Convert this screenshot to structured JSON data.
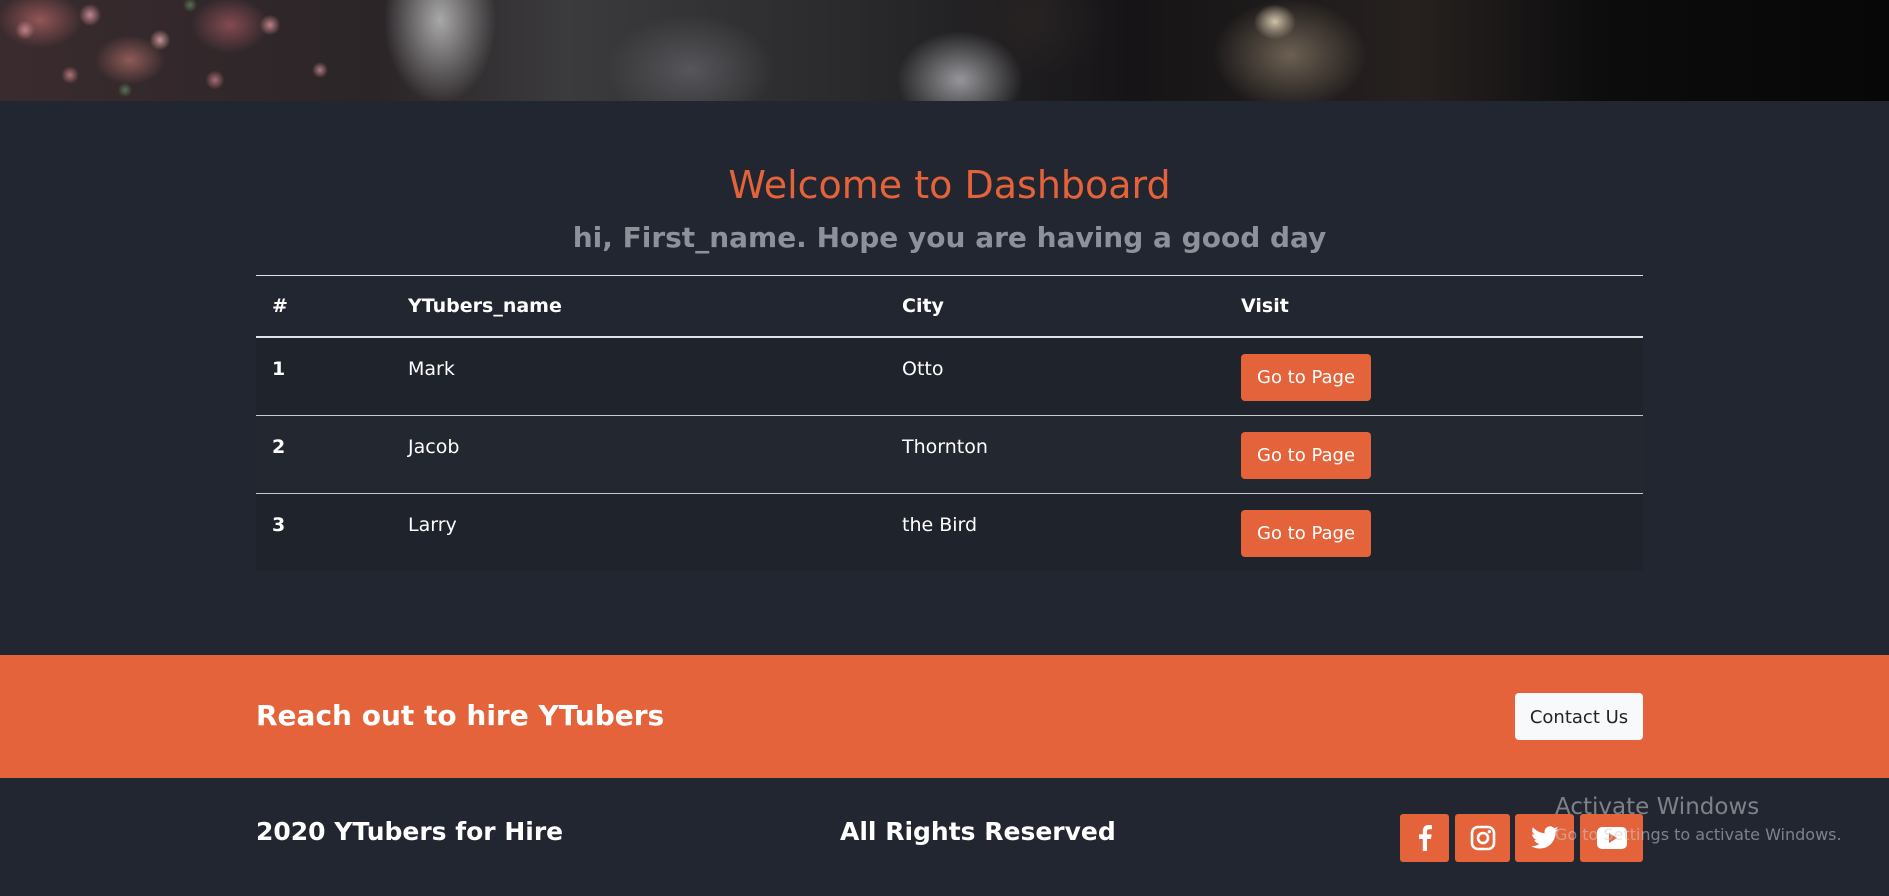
{
  "hero": {
    "image_name": "hero-photo"
  },
  "dashboard": {
    "title": "Welcome to Dashboard",
    "subtitle": "hi, First_name. Hope you are having a good day"
  },
  "table": {
    "headers": [
      "#",
      "YTubers_name",
      "City",
      "Visit"
    ],
    "rows": [
      {
        "num": "1",
        "name": "Mark",
        "city": "Otto",
        "button": "Go to Page"
      },
      {
        "num": "2",
        "name": "Jacob",
        "city": "Thornton",
        "button": "Go to Page"
      },
      {
        "num": "3",
        "name": "Larry",
        "city": "the Bird",
        "button": "Go to Page"
      }
    ]
  },
  "cta": {
    "text": "Reach out to hire YTubers",
    "button_label": "Contact Us"
  },
  "footer": {
    "copyright": "2020 YTubers for Hire",
    "rights": "All Rights Reserved",
    "social_icons": [
      "facebook-icon",
      "instagram-icon",
      "twitter-icon",
      "youtube-icon"
    ]
  },
  "watermark": {
    "title": "Activate Windows",
    "subtitle": "Go to Settings to activate Windows."
  },
  "colors": {
    "accent": "#e5633a",
    "background": "#222630",
    "muted_text": "#8d9199"
  }
}
